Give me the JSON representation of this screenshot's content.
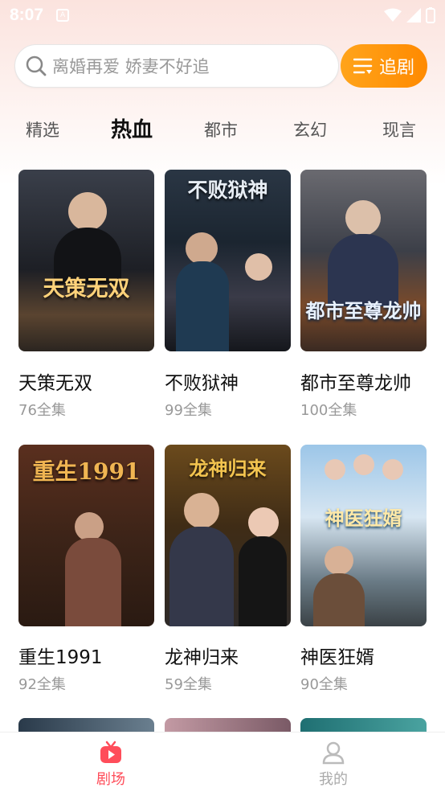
{
  "status_bar": {
    "time": "8:07"
  },
  "search": {
    "placeholder": "离婚再爱 娇妻不好追",
    "follow_button_label": "追剧"
  },
  "tabs": [
    {
      "label": "精选",
      "active": false
    },
    {
      "label": "热血",
      "active": true
    },
    {
      "label": "都市",
      "active": false
    },
    {
      "label": "玄幻",
      "active": false
    },
    {
      "label": "现言",
      "active": false
    }
  ],
  "dramas": [
    {
      "title": "天策无双",
      "episodes": "76全集",
      "poster_text": "天策无双"
    },
    {
      "title": "不败狱神",
      "episodes": "99全集",
      "poster_text": "不败狱神"
    },
    {
      "title": "都市至尊龙帅",
      "episodes": "100全集",
      "poster_text": "都市至尊龙帅"
    },
    {
      "title": "重生1991",
      "episodes": "92全集",
      "poster_text": "重生1991"
    },
    {
      "title": "龙神归来",
      "episodes": "59全集",
      "poster_text": "龙神归来"
    },
    {
      "title": "神医狂婿",
      "episodes": "90全集",
      "poster_text": "神医狂婿"
    }
  ],
  "bottom_nav": [
    {
      "label": "剧场",
      "icon": "tv-icon",
      "active": true,
      "color": "#ff4d5a"
    },
    {
      "label": "我的",
      "icon": "person-icon",
      "active": false,
      "color": "#bbbbbb"
    }
  ],
  "colors": {
    "accent": "#ff9500",
    "nav_active": "#ff4d5a"
  }
}
